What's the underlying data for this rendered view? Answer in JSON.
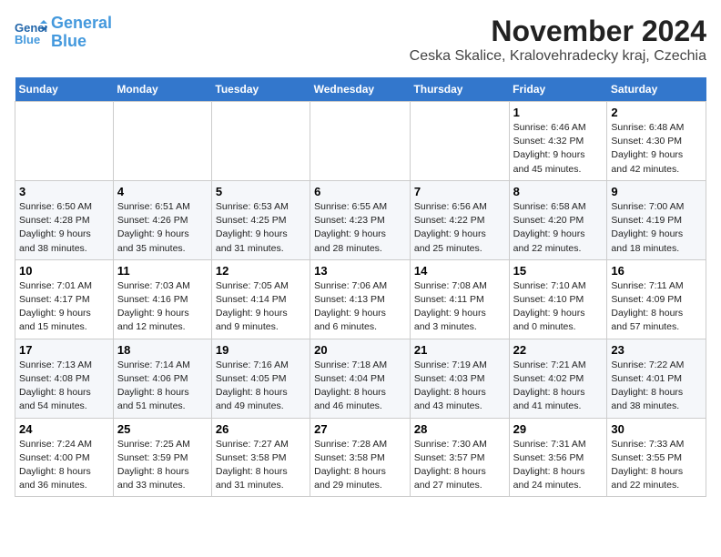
{
  "logo": {
    "line1": "General",
    "line2": "Blue"
  },
  "title": "November 2024",
  "location": "Ceska Skalice, Kralovehradecky kraj, Czechia",
  "weekdays": [
    "Sunday",
    "Monday",
    "Tuesday",
    "Wednesday",
    "Thursday",
    "Friday",
    "Saturday"
  ],
  "weeks": [
    [
      {
        "day": "",
        "info": ""
      },
      {
        "day": "",
        "info": ""
      },
      {
        "day": "",
        "info": ""
      },
      {
        "day": "",
        "info": ""
      },
      {
        "day": "",
        "info": ""
      },
      {
        "day": "1",
        "info": "Sunrise: 6:46 AM\nSunset: 4:32 PM\nDaylight: 9 hours\nand 45 minutes."
      },
      {
        "day": "2",
        "info": "Sunrise: 6:48 AM\nSunset: 4:30 PM\nDaylight: 9 hours\nand 42 minutes."
      }
    ],
    [
      {
        "day": "3",
        "info": "Sunrise: 6:50 AM\nSunset: 4:28 PM\nDaylight: 9 hours\nand 38 minutes."
      },
      {
        "day": "4",
        "info": "Sunrise: 6:51 AM\nSunset: 4:26 PM\nDaylight: 9 hours\nand 35 minutes."
      },
      {
        "day": "5",
        "info": "Sunrise: 6:53 AM\nSunset: 4:25 PM\nDaylight: 9 hours\nand 31 minutes."
      },
      {
        "day": "6",
        "info": "Sunrise: 6:55 AM\nSunset: 4:23 PM\nDaylight: 9 hours\nand 28 minutes."
      },
      {
        "day": "7",
        "info": "Sunrise: 6:56 AM\nSunset: 4:22 PM\nDaylight: 9 hours\nand 25 minutes."
      },
      {
        "day": "8",
        "info": "Sunrise: 6:58 AM\nSunset: 4:20 PM\nDaylight: 9 hours\nand 22 minutes."
      },
      {
        "day": "9",
        "info": "Sunrise: 7:00 AM\nSunset: 4:19 PM\nDaylight: 9 hours\nand 18 minutes."
      }
    ],
    [
      {
        "day": "10",
        "info": "Sunrise: 7:01 AM\nSunset: 4:17 PM\nDaylight: 9 hours\nand 15 minutes."
      },
      {
        "day": "11",
        "info": "Sunrise: 7:03 AM\nSunset: 4:16 PM\nDaylight: 9 hours\nand 12 minutes."
      },
      {
        "day": "12",
        "info": "Sunrise: 7:05 AM\nSunset: 4:14 PM\nDaylight: 9 hours\nand 9 minutes."
      },
      {
        "day": "13",
        "info": "Sunrise: 7:06 AM\nSunset: 4:13 PM\nDaylight: 9 hours\nand 6 minutes."
      },
      {
        "day": "14",
        "info": "Sunrise: 7:08 AM\nSunset: 4:11 PM\nDaylight: 9 hours\nand 3 minutes."
      },
      {
        "day": "15",
        "info": "Sunrise: 7:10 AM\nSunset: 4:10 PM\nDaylight: 9 hours\nand 0 minutes."
      },
      {
        "day": "16",
        "info": "Sunrise: 7:11 AM\nSunset: 4:09 PM\nDaylight: 8 hours\nand 57 minutes."
      }
    ],
    [
      {
        "day": "17",
        "info": "Sunrise: 7:13 AM\nSunset: 4:08 PM\nDaylight: 8 hours\nand 54 minutes."
      },
      {
        "day": "18",
        "info": "Sunrise: 7:14 AM\nSunset: 4:06 PM\nDaylight: 8 hours\nand 51 minutes."
      },
      {
        "day": "19",
        "info": "Sunrise: 7:16 AM\nSunset: 4:05 PM\nDaylight: 8 hours\nand 49 minutes."
      },
      {
        "day": "20",
        "info": "Sunrise: 7:18 AM\nSunset: 4:04 PM\nDaylight: 8 hours\nand 46 minutes."
      },
      {
        "day": "21",
        "info": "Sunrise: 7:19 AM\nSunset: 4:03 PM\nDaylight: 8 hours\nand 43 minutes."
      },
      {
        "day": "22",
        "info": "Sunrise: 7:21 AM\nSunset: 4:02 PM\nDaylight: 8 hours\nand 41 minutes."
      },
      {
        "day": "23",
        "info": "Sunrise: 7:22 AM\nSunset: 4:01 PM\nDaylight: 8 hours\nand 38 minutes."
      }
    ],
    [
      {
        "day": "24",
        "info": "Sunrise: 7:24 AM\nSunset: 4:00 PM\nDaylight: 8 hours\nand 36 minutes."
      },
      {
        "day": "25",
        "info": "Sunrise: 7:25 AM\nSunset: 3:59 PM\nDaylight: 8 hours\nand 33 minutes."
      },
      {
        "day": "26",
        "info": "Sunrise: 7:27 AM\nSunset: 3:58 PM\nDaylight: 8 hours\nand 31 minutes."
      },
      {
        "day": "27",
        "info": "Sunrise: 7:28 AM\nSunset: 3:58 PM\nDaylight: 8 hours\nand 29 minutes."
      },
      {
        "day": "28",
        "info": "Sunrise: 7:30 AM\nSunset: 3:57 PM\nDaylight: 8 hours\nand 27 minutes."
      },
      {
        "day": "29",
        "info": "Sunrise: 7:31 AM\nSunset: 3:56 PM\nDaylight: 8 hours\nand 24 minutes."
      },
      {
        "day": "30",
        "info": "Sunrise: 7:33 AM\nSunset: 3:55 PM\nDaylight: 8 hours\nand 22 minutes."
      }
    ]
  ]
}
